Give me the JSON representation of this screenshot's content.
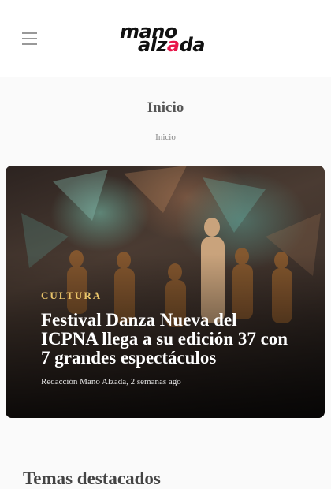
{
  "header": {
    "logo_line1": "mano",
    "logo_line2_a": "alz",
    "logo_line2_accent": "a",
    "logo_line2_b": "da",
    "menu_icon": "hamburger-menu-icon"
  },
  "page": {
    "title": "Inicio",
    "breadcrumb": "Inicio"
  },
  "hero": {
    "category": "CULTURA",
    "title": "Festival Danza Nueva del ICPNA llega a su edición 37 con 7 grandes espectáculos",
    "meta": "Redacción Mano Alzada, 2 semanas ago"
  },
  "sections": {
    "featured_title": "Temas destacados"
  },
  "colors": {
    "accent": "#e8174a",
    "category": "#e9c46a"
  }
}
